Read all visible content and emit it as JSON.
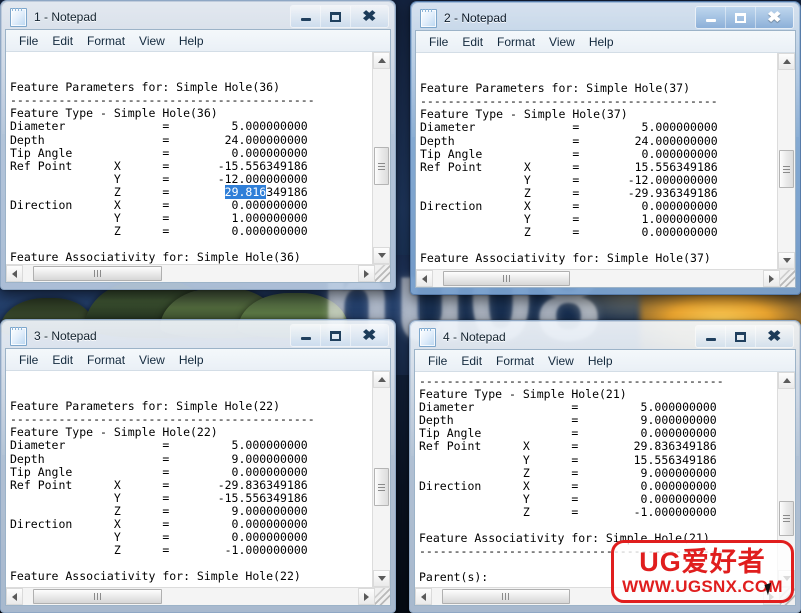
{
  "desktop": {
    "wallpaper_text": "nu08",
    "colors": {
      "sea": "#1d3158",
      "sky": "#14233f",
      "sun": "#ffd15a",
      "island": "#3b5030"
    }
  },
  "watermark": {
    "line1": "UG爱好者",
    "line2": "WWW.UGSNX.COM",
    "color": "#e01e1e"
  },
  "menu": {
    "file": "File",
    "edit": "Edit",
    "format": "Format",
    "view": "View",
    "help": "Help"
  },
  "controls": {
    "minimize": "minimize",
    "maximize": "maximize",
    "close": "close"
  },
  "windows": [
    {
      "id": "win1",
      "title": "1 - Notepad",
      "active": false,
      "text_before": "\n\nFeature Parameters for: Simple Hole(36)\n--------------------------------------------\nFeature Type - Simple Hole(36)\nDiameter              =         5.000000000\nDepth                 =        24.000000000\nTip Angle             =         0.000000000\nRef Point      X      =       -15.556349186\n               Y      =       -12.000000000\n               Z      =        ",
      "selection": "29.816",
      "text_after": "349186\nDirection      X      =         0.000000000\n               Y      =         1.000000000\n               Z      =         0.000000000\n\nFeature Associativity for: Simple Hole(36)",
      "scroll": {
        "v_thumb_top_pct": 44,
        "v_thumb_height_pct": 20,
        "h_thumb_left_pct": 3,
        "h_thumb_width_pct": 38
      }
    },
    {
      "id": "win2",
      "title": "2 - Notepad",
      "active": true,
      "text": "\n\nFeature Parameters for: Simple Hole(37)\n-------------------------------------------\nFeature Type - Simple Hole(37)\nDiameter              =         5.000000000\nDepth                 =        24.000000000\nTip Angle             =         0.000000000\nRef Point      X      =        15.556349186\n               Y      =       -12.000000000\n               Z      =       -29.936349186\nDirection      X      =         0.000000000\n               Y      =         1.000000000\n               Z      =         0.000000000\n\nFeature Associativity for: Simple Hole(37)",
      "scroll": {
        "v_thumb_top_pct": 44,
        "v_thumb_height_pct": 20,
        "h_thumb_left_pct": 3,
        "h_thumb_width_pct": 38
      }
    },
    {
      "id": "win3",
      "title": "3 - Notepad",
      "active": false,
      "text": "\n\nFeature Parameters for: Simple Hole(22)\n--------------------------------------------\nFeature Type - Simple Hole(22)\nDiameter              =         5.000000000\nDepth                 =         9.000000000\nTip Angle             =         0.000000000\nRef Point      X      =       -29.836349186\n               Y      =       -15.556349186\n               Z      =         9.000000000\nDirection      X      =         0.000000000\n               Y      =         0.000000000\n               Z      =        -1.000000000\n\nFeature Associativity for: Simple Hole(22)",
      "scroll": {
        "v_thumb_top_pct": 44,
        "v_thumb_height_pct": 20,
        "h_thumb_left_pct": 3,
        "h_thumb_width_pct": 38
      }
    },
    {
      "id": "win4",
      "title": "4 - Notepad",
      "active": false,
      "text": "--------------------------------------------\nFeature Type - Simple Hole(21)\nDiameter              =         5.000000000\nDepth                 =         9.000000000\nTip Angle             =         0.000000000\nRef Point      X      =        29.836349186\n               Y      =        15.556349186\n               Z      =         9.000000000\nDirection      X      =         0.000000000\n               Y      =         0.000000000\n               Z      =        -1.000000000\n\nFeature Associativity for: Simple Hole(21)\n--------------------------------------------\n\nParent(s):",
      "scroll": {
        "v_thumb_top_pct": 62,
        "v_thumb_height_pct": 18,
        "h_thumb_left_pct": 3,
        "h_thumb_width_pct": 38
      }
    }
  ]
}
